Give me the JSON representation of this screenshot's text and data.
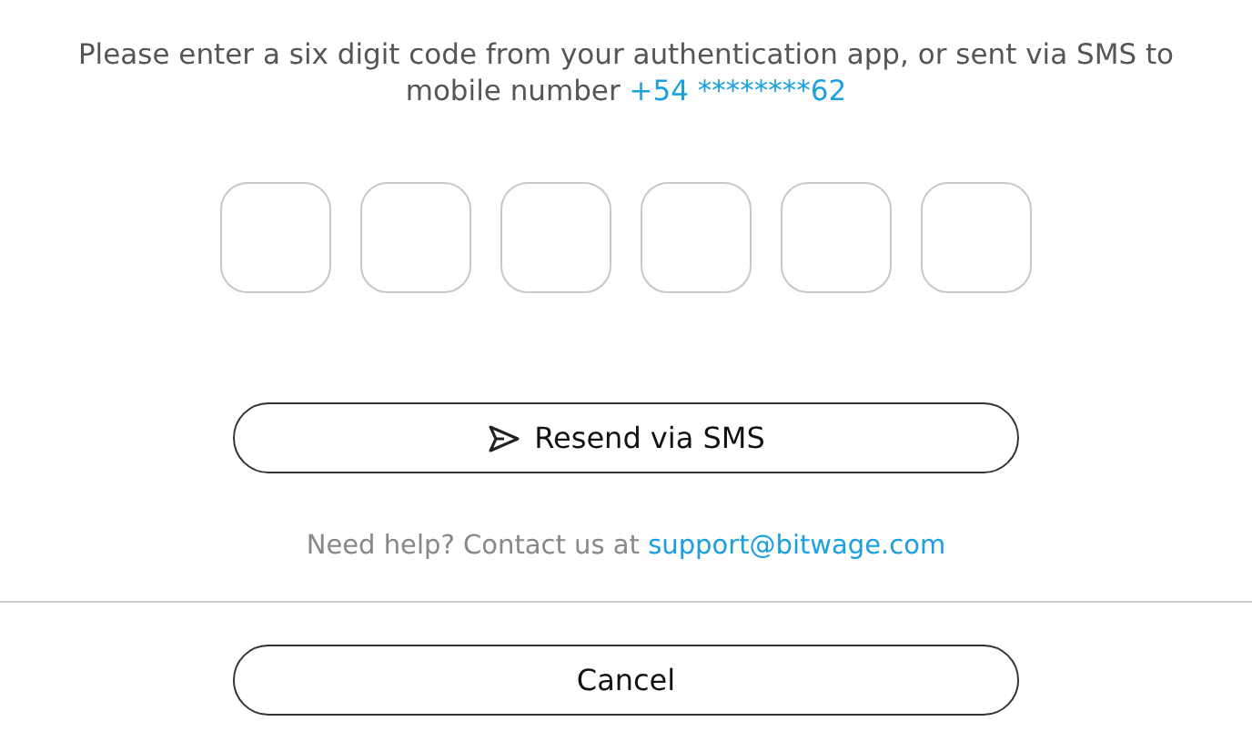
{
  "instruction": {
    "text": "Please enter a six digit code from your authentication app, or sent via SMS to mobile number",
    "phone": "+54 ********62"
  },
  "code_inputs": [
    {
      "kind": "digit"
    },
    {
      "kind": "digit"
    },
    {
      "kind": "digit"
    },
    {
      "kind": "digit"
    },
    {
      "kind": "digit"
    },
    {
      "kind": "digit"
    }
  ],
  "resend_button": {
    "label": "Resend via SMS"
  },
  "help": {
    "text": "Need help? Contact us at",
    "email": "support@bitwage.com"
  },
  "cancel_button": {
    "label": "Cancel"
  }
}
